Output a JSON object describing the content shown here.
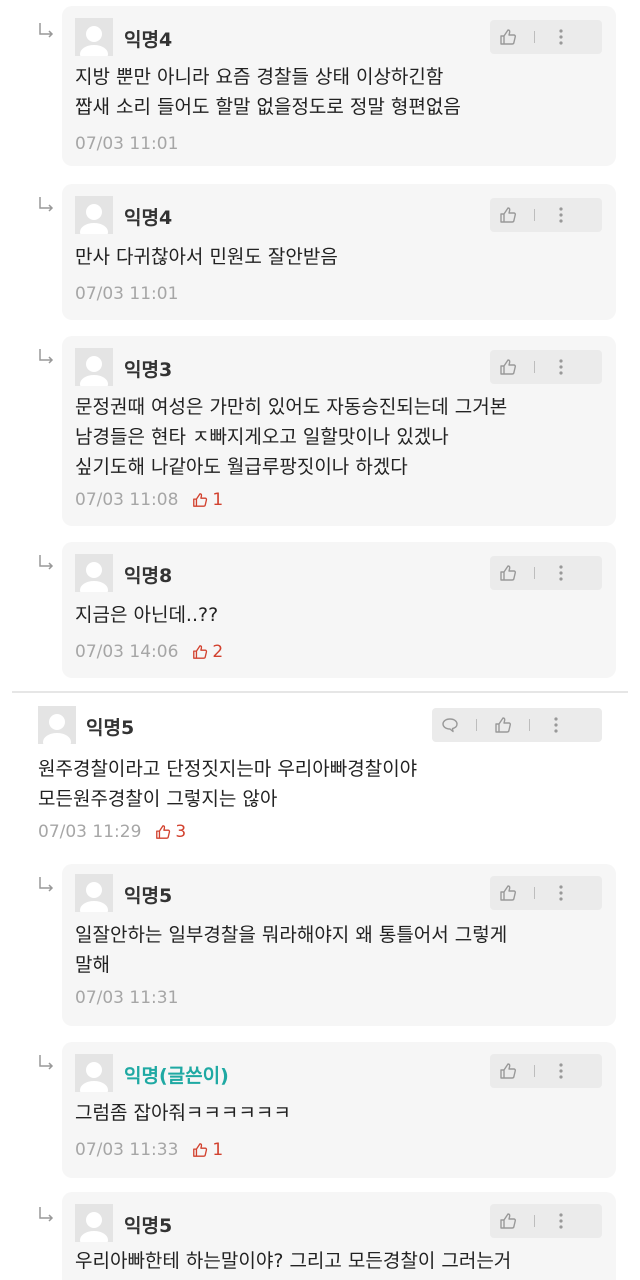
{
  "colors": {
    "author_name": "#1fa9a3",
    "like_count": "#d2422f",
    "meta": "#a6a6a6"
  },
  "comments": [
    {
      "name": "익명4",
      "lines": [
        "지방 뿐만 아니라 요즘 경찰들 상태 이상하긴함",
        "짭새 소리 들어도 할말 없을정도로 정말 형편없음"
      ],
      "time": "07/03 11:01",
      "likes": ""
    },
    {
      "name": "익명4",
      "lines": [
        "만사 다귀찮아서 민원도 잘안받음"
      ],
      "time": "07/03 11:01",
      "likes": ""
    },
    {
      "name": "익명3",
      "lines": [
        "문정권때 여성은 가만히 있어도 자동승진되는데 그거본",
        "남경들은 현타 ㅈ빠지게오고 일할맛이나 있겠나",
        "싶기도해 나같아도 월급루팡짓이나 하겠다"
      ],
      "time": "07/03 11:08",
      "likes": "1"
    },
    {
      "name": "익명8",
      "lines": [
        "지금은 아닌데..??"
      ],
      "time": "07/03 14:06",
      "likes": "2"
    },
    {
      "name": "익명5",
      "lines": [
        "원주경찰이라고 단정짓지는마 우리아빠경찰이야",
        "모든원주경찰이 그렇지는 않아"
      ],
      "time": "07/03 11:29",
      "likes": "3"
    },
    {
      "name": "익명5",
      "lines": [
        "일잘안하는 일부경찰을 뭐라해야지 왜 통틀어서 그렇게",
        "말해"
      ],
      "time": "07/03 11:31",
      "likes": ""
    },
    {
      "name": "익명(글쓴이)",
      "lines": [
        "그럼좀 잡아줘ㅋㅋㅋㅋㅋㅋ"
      ],
      "time": "07/03 11:33",
      "likes": "1"
    },
    {
      "name": "익명5",
      "lines": [
        "우리아빠한테 하는말이야? 그리고 모든경찰이 그러는거"
      ],
      "time": "",
      "likes": ""
    }
  ]
}
